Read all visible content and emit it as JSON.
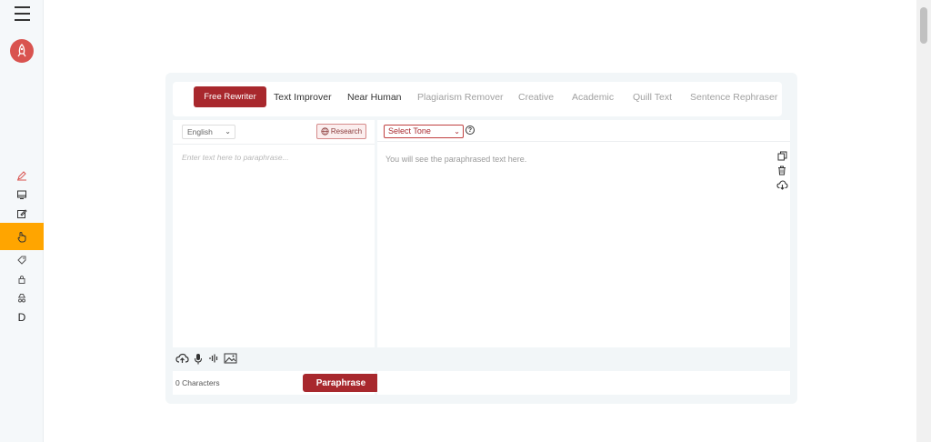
{
  "sidebar": {
    "menu_icon": "hamburger-icon",
    "logo_icon": "rocket-icon",
    "items": [
      {
        "icon": "pen-icon"
      },
      {
        "icon": "monitor-icon"
      },
      {
        "icon": "edit-icon"
      },
      {
        "icon": "hand-pointer-icon",
        "active": true
      },
      {
        "icon": "tag-icon"
      },
      {
        "icon": "lock-icon"
      },
      {
        "icon": "incognito-icon"
      },
      {
        "label": "D"
      }
    ]
  },
  "tabs": {
    "active": "Free Rewriter",
    "items": [
      "Text Improver",
      "Near Human",
      "Plagiarism Remover",
      "Creative",
      "Academic",
      "Quill Text",
      "Sentence Rephraser"
    ]
  },
  "input": {
    "language": "English",
    "research_label": "Research",
    "placeholder": "Enter text here to paraphrase...",
    "char_count": "0 Characters",
    "paraphrase_label": "Paraphrase",
    "footer_icons": [
      "cloud-upload-icon",
      "microphone-icon",
      "audio-wave-icon",
      "image-icon"
    ]
  },
  "output": {
    "tone_label": "Select Tone",
    "help_icon": "question-circle-icon",
    "placeholder": "You will see the paraphrased text here.",
    "tools": [
      "copy-icon",
      "trash-icon",
      "cloud-download-icon"
    ]
  },
  "colors": {
    "accent": "#a8282d",
    "active_sidebar": "#ffa500"
  }
}
